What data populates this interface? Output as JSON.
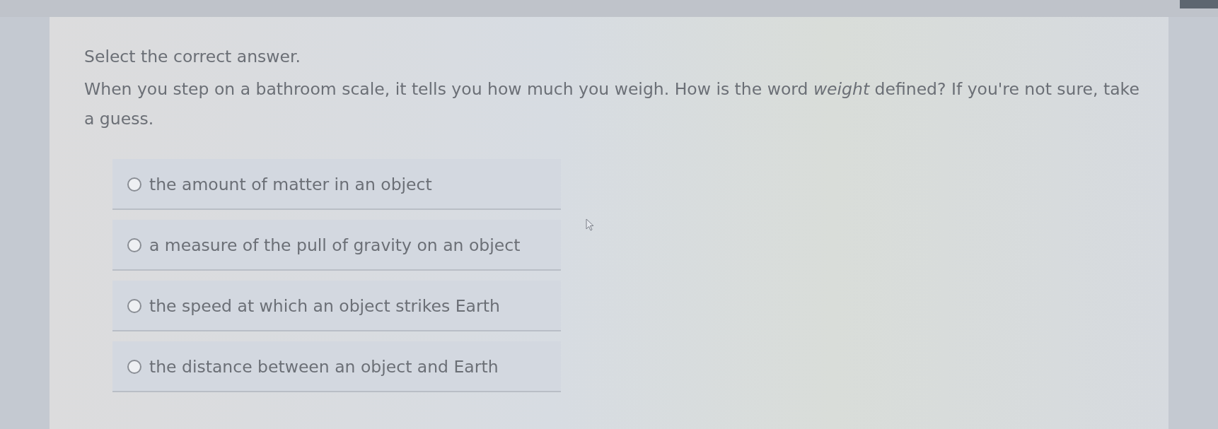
{
  "instruction": "Select the correct answer.",
  "question": "When you step on a bathroom scale, it tells you how much you weigh. How is the word *weight* defined? If you're not sure, take a guess.",
  "options": [
    {
      "label": "the amount of matter in an object",
      "selected": false
    },
    {
      "label": "a measure of the pull of gravity on an object",
      "selected": false
    },
    {
      "label": "the speed at which an object strikes Earth",
      "selected": false
    },
    {
      "label": "the distance between an object and Earth",
      "selected": false
    }
  ]
}
